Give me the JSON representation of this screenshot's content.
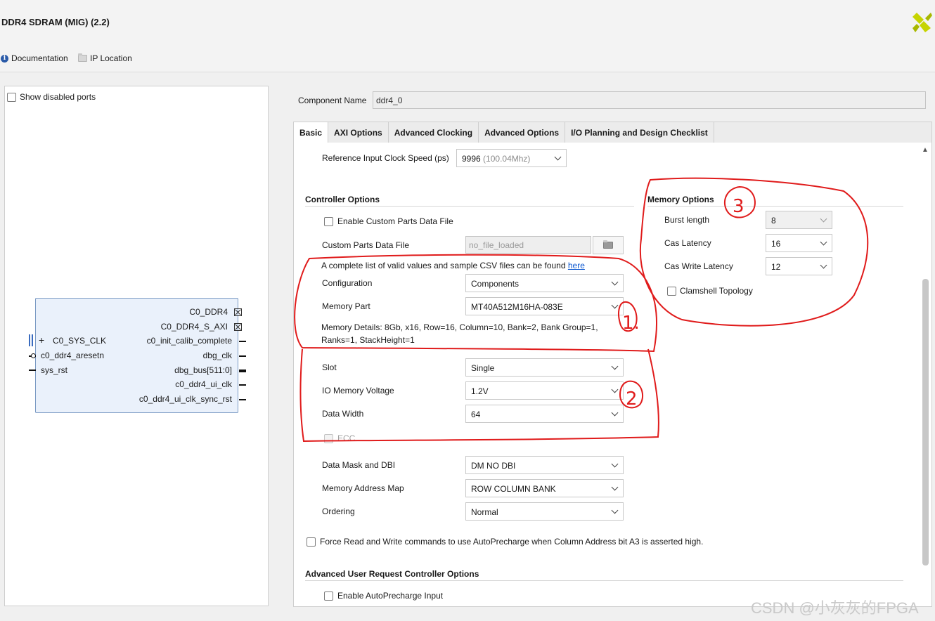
{
  "window": {
    "title": "DDR4 SDRAM (MIG) (2.2)"
  },
  "header_links": {
    "documentation": "Documentation",
    "ip_location": "IP Location"
  },
  "left_panel": {
    "show_disabled_ports": "Show disabled ports",
    "block": {
      "right_ports": [
        "C0_DDR4",
        "C0_DDR4_S_AXI",
        "c0_init_calib_complete",
        "dbg_clk",
        "dbg_bus[511:0]",
        "c0_ddr4_ui_clk",
        "c0_ddr4_ui_clk_sync_rst"
      ],
      "left_ports": [
        "C0_SYS_CLK",
        "c0_ddr4_aresetn",
        "sys_rst"
      ]
    }
  },
  "component_name": {
    "label": "Component Name",
    "value": "ddr4_0"
  },
  "tabs": [
    "Basic",
    "AXI Options",
    "Advanced Clocking",
    "Advanced Options",
    "I/O Planning and Design Checklist"
  ],
  "basic": {
    "ref_clock": {
      "label": "Reference Input Clock Speed (ps)",
      "value": "9996",
      "hint": "(100.04Mhz)"
    },
    "controller_options": {
      "title": "Controller Options",
      "enable_custom_parts": "Enable Custom Parts Data File",
      "custom_parts_file": {
        "label": "Custom Parts Data File",
        "value": "no_file_loaded"
      },
      "csv_note": "A complete list of valid values and sample CSV files can be found",
      "csv_link": "here",
      "configuration": {
        "label": "Configuration",
        "value": "Components"
      },
      "memory_part": {
        "label": "Memory Part",
        "value": "MT40A512M16HA-083E"
      },
      "memory_details_1": "Memory Details: 8Gb, x16, Row=16, Column=10, Bank=2, Bank Group=1,",
      "memory_details_2": "Ranks=1, StackHeight=1",
      "slot": {
        "label": "Slot",
        "value": "Single"
      },
      "io_voltage": {
        "label": "IO Memory Voltage",
        "value": "1.2V"
      },
      "data_width": {
        "label": "Data Width",
        "value": "64"
      },
      "ecc": "ECC",
      "data_mask": {
        "label": "Data Mask and DBI",
        "value": "DM NO DBI"
      },
      "address_map": {
        "label": "Memory Address Map",
        "value": "ROW COLUMN BANK"
      },
      "ordering": {
        "label": "Ordering",
        "value": "Normal"
      },
      "force_autoprecharge": "Force Read and Write commands to use AutoPrecharge when Column Address bit A3 is asserted high."
    },
    "memory_options": {
      "title": "Memory Options",
      "burst_length": {
        "label": "Burst length",
        "value": "8"
      },
      "cas_latency": {
        "label": "Cas Latency",
        "value": "16"
      },
      "cas_write_latency": {
        "label": "Cas Write Latency",
        "value": "12"
      },
      "clamshell": "Clamshell Topology"
    },
    "advanced_user_request": {
      "title": "Advanced User Request Controller Options",
      "enable_autoprecharge": "Enable AutoPrecharge Input"
    }
  },
  "annotations": {
    "circle_1": "1.",
    "circle_2": "2",
    "circle_3": "3"
  },
  "watermark": "CSDN @小灰灰的FPGA",
  "colors": {
    "annotation": "#e01b1b",
    "link": "#0b57d0",
    "block_fill": "#eaf1fb",
    "block_border": "#7c9bc4"
  }
}
